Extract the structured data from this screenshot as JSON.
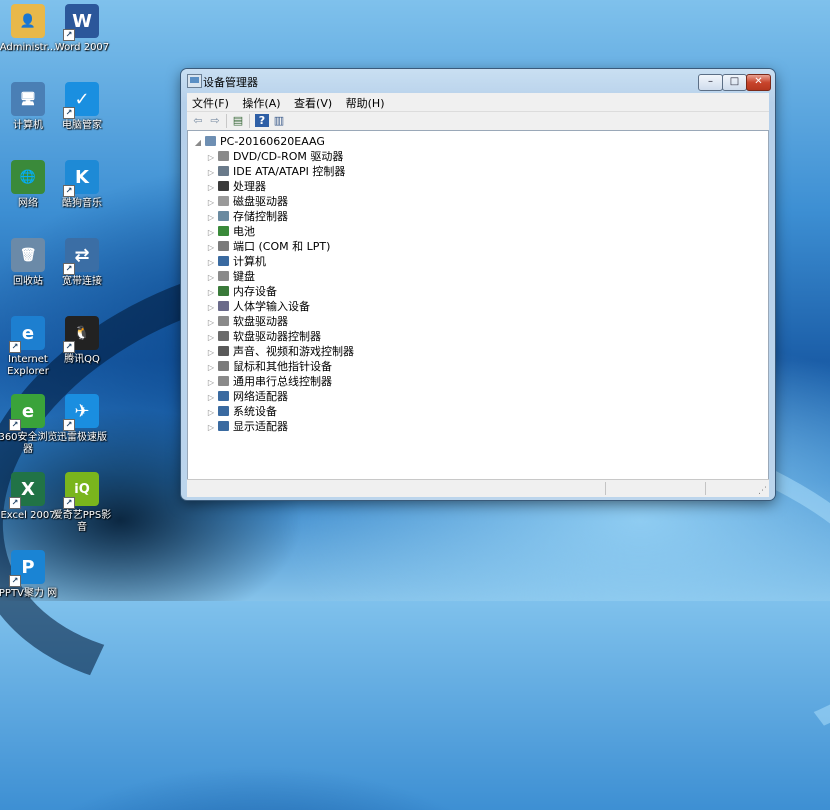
{
  "desktop": {
    "icons": [
      {
        "label": "Administr...",
        "glyph": "👤",
        "color": "#e8b84a"
      },
      {
        "label": "Word 2007",
        "glyph": "W",
        "color": "#2b579a"
      },
      {
        "label": "计算机",
        "glyph": "🖥",
        "color": "#4a7fb5"
      },
      {
        "label": "电脑管家",
        "glyph": "✓",
        "color": "#1a8fe0"
      },
      {
        "label": "网络",
        "glyph": "🌐",
        "color": "#3a8a3a"
      },
      {
        "label": "酷狗音乐",
        "glyph": "K",
        "color": "#1e8ad6"
      },
      {
        "label": "回收站",
        "glyph": "🗑",
        "color": "#6b8aa8"
      },
      {
        "label": "宽带连接",
        "glyph": "⇄",
        "color": "#3b6ea5"
      },
      {
        "label": "Internet Explorer",
        "glyph": "e",
        "color": "#1d7fd0"
      },
      {
        "label": "腾讯QQ",
        "glyph": "🐧",
        "color": "#222"
      },
      {
        "label": "360安全浏览器",
        "glyph": "e",
        "color": "#3aa33a"
      },
      {
        "label": "迅雷极速版",
        "glyph": "✈",
        "color": "#1a8ee0"
      },
      {
        "label": "Excel 2007",
        "glyph": "X",
        "color": "#217346"
      },
      {
        "label": "爱奇艺PPS影音",
        "glyph": "iQ",
        "color": "#7ab51d"
      },
      {
        "label": "PPTV聚力 网",
        "glyph": "P",
        "color": "#1a84d4"
      }
    ]
  },
  "window": {
    "title": "设备管理器",
    "controls": {
      "min": "–",
      "max": "□",
      "close": "✕"
    },
    "menu": [
      "文件(F)",
      "操作(A)",
      "查看(V)",
      "帮助(H)"
    ],
    "toolbar": {
      "back": "⇦",
      "forward": "⇨",
      "properties": "▤",
      "help": "?",
      "view": "▥"
    },
    "tree": {
      "root": "PC-20160620EAAG",
      "items": [
        "DVD/CD-ROM 驱动器",
        "IDE ATA/ATAPI 控制器",
        "处理器",
        "磁盘驱动器",
        "存储控制器",
        "电池",
        "端口 (COM 和 LPT)",
        "计算机",
        "键盘",
        "内存设备",
        "人体学输入设备",
        "软盘驱动器",
        "软盘驱动器控制器",
        "声音、视频和游戏控制器",
        "鼠标和其他指针设备",
        "通用串行总线控制器",
        "网络适配器",
        "系统设备",
        "显示适配器"
      ]
    },
    "status": ""
  }
}
